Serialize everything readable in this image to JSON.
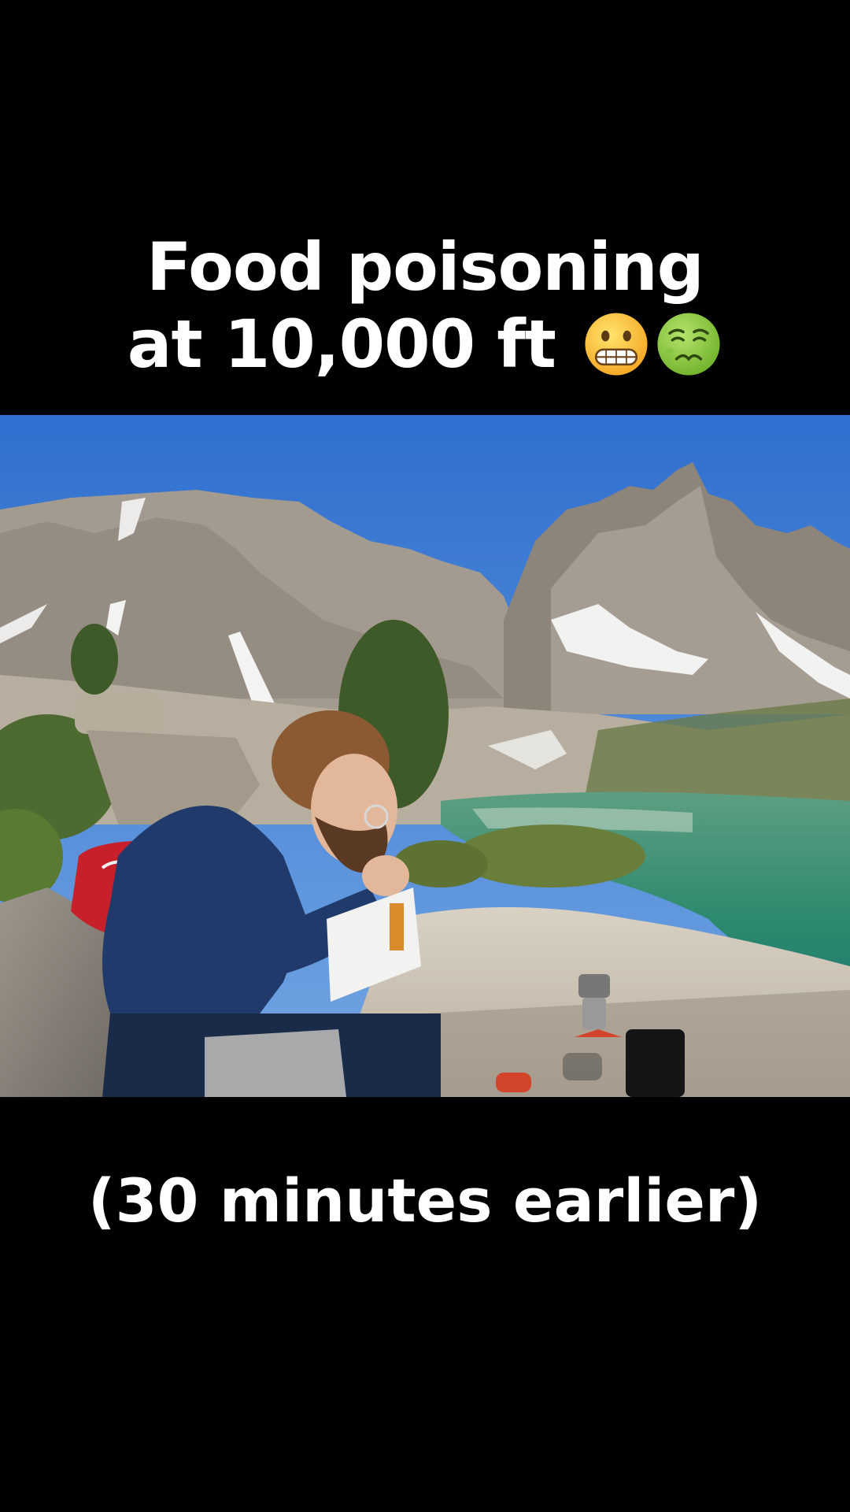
{
  "caption": {
    "line1": "Food poisoning",
    "line2": "at 10,000 ft",
    "emoji_1": "grimacing-face-emoji",
    "emoji_2": "nauseated-face-emoji"
  },
  "subcaption": "(30 minutes earlier)",
  "scene": {
    "description_icon": "photo-scene",
    "colors": {
      "sky": "#3d7fd6",
      "lake": "#2e8a6e",
      "jacket": "#1f3a6b",
      "backpack": "#c8202a",
      "rock": "#c9c2b4"
    }
  }
}
